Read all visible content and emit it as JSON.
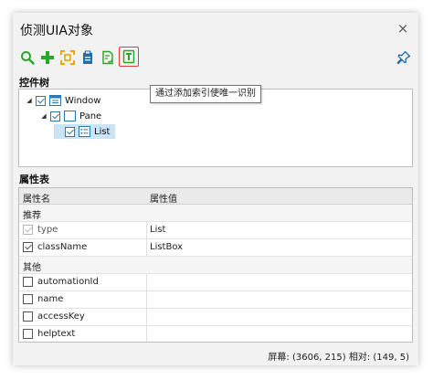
{
  "window": {
    "title": "侦测UIA对象",
    "close_glyph": "×"
  },
  "toolbar": {
    "buttons": [
      "search-icon",
      "add-icon",
      "capture-icon",
      "clipboard-icon",
      "validate-icon",
      "index-icon"
    ],
    "tooltip": "通过添加索引使唯一识别",
    "colors": {
      "green": "#2aa62a",
      "yellow": "#e6a800",
      "blue": "#1e6ba8",
      "highlight": "#e23b3b"
    }
  },
  "tree_section": {
    "title": "控件树",
    "nodes": [
      {
        "label": "Window",
        "expander": "◢",
        "checked": true,
        "icon": "window-icon"
      },
      {
        "label": "Pane",
        "expander": "◢",
        "checked": true,
        "icon": "pane-icon"
      },
      {
        "label": "List",
        "expander": "",
        "checked": true,
        "icon": "list-icon",
        "selected": true
      }
    ]
  },
  "props_section": {
    "title": "属性表",
    "col_name": "属性名",
    "col_value": "属性值",
    "groups": {
      "recommended": "推荐",
      "other": "其他"
    },
    "rows": {
      "type": {
        "name": "type",
        "value": "List",
        "checked": true,
        "disabled": true
      },
      "className": {
        "name": "className",
        "value": "ListBox",
        "checked": true
      },
      "automationId": {
        "name": "automationId",
        "value": "",
        "checked": false
      },
      "name": {
        "name": "name",
        "value": "",
        "checked": false
      },
      "accessKey": {
        "name": "accessKey",
        "value": "",
        "checked": false
      },
      "helptext": {
        "name": "helptext",
        "value": "",
        "checked": false
      }
    }
  },
  "status": "屏幕: (3606, 215)  相对: (149, 5)"
}
